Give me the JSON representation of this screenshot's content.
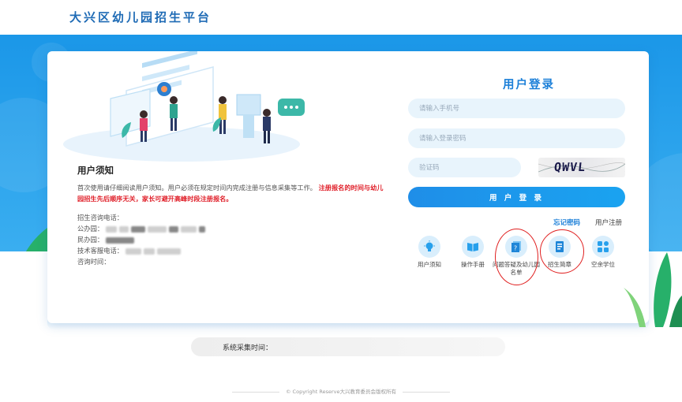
{
  "header": {
    "site_title": "大兴区幼儿园招生平台"
  },
  "notice": {
    "title": "用户须知",
    "text": "首次使用请仔细阅读用户须知。用户必须在规定时间内完成注册与信息采集等工作。",
    "text_red": "注册报名的时间与幼儿园招生先后顺序无关，家长可避开高峰时段注册报名。"
  },
  "contact": {
    "enroll_phone_label": "招生咨询电话：",
    "public_label": "公办园：",
    "private_label": "民办园：",
    "tech_phone_label": "技术客服电话：",
    "hours_label": "咨询时间："
  },
  "login": {
    "title": "用户登录",
    "phone_placeholder": "请输入手机号",
    "password_placeholder": "请输入登录密码",
    "captcha_placeholder": "验证码",
    "captcha_text": "QWVL",
    "submit_label": "用 户 登 录",
    "forgot_label": "忘记密码",
    "register_label": "用户注册"
  },
  "tools": [
    {
      "label": "用户须知",
      "icon": "lightbulb-icon"
    },
    {
      "label": "操作手册",
      "icon": "book-icon"
    },
    {
      "label": "问题答疑及幼儿园名单",
      "icon": "question-doc-icon"
    },
    {
      "label": "招生简章",
      "icon": "brochure-icon"
    },
    {
      "label": "空余学位",
      "icon": "grid-icon"
    }
  ],
  "footer": {
    "collect_time_label": "系统采集时间：",
    "copyright": "© Copyright Reserve大兴教育委员会版权所有"
  },
  "colors": {
    "primary": "#1b7fd8",
    "banner": "#1b97e8",
    "alert": "#e0202a",
    "annotation": "#e02020"
  }
}
